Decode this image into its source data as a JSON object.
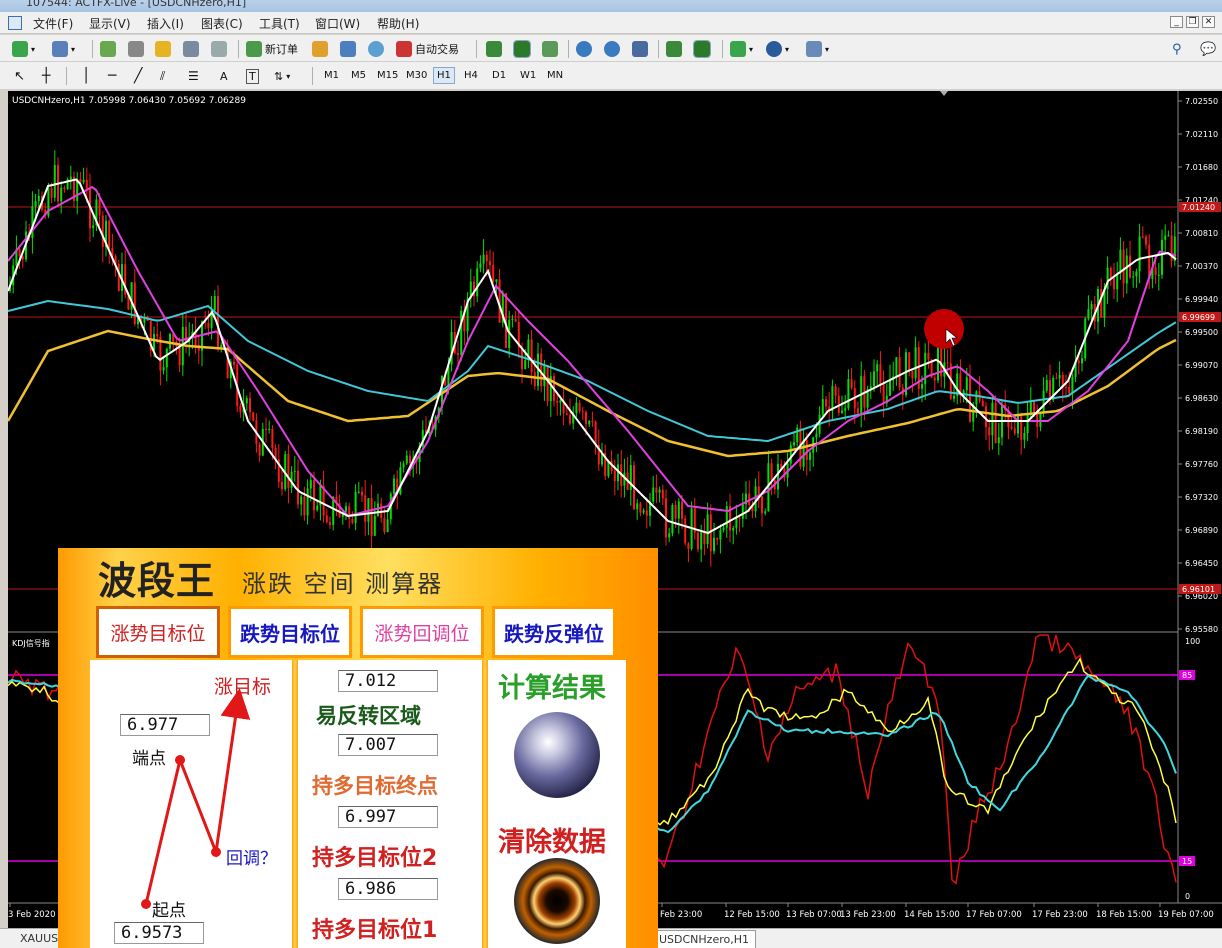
{
  "window": {
    "title": "107544: ACTFX-Live - [USDCNHzero,H1]"
  },
  "menu": [
    "文件(F)",
    "显示(V)",
    "插入(I)",
    "图表(C)",
    "工具(T)",
    "窗口(W)",
    "帮助(H)"
  ],
  "toolbar": {
    "new_order": "新订单",
    "auto_trade": "自动交易"
  },
  "timeframes": [
    "M1",
    "M5",
    "M15",
    "M30",
    "H1",
    "H4",
    "D1",
    "W1",
    "MN"
  ],
  "active_timeframe": "H1",
  "chart": {
    "header": "USDCNHzero,H1  7.05998 7.06430 7.05692 7.06289",
    "price_axis": [
      "7.02550",
      "7.02110",
      "7.01680",
      "7.01240",
      "7.00810",
      "7.00370",
      "6.99940",
      "6.99500",
      "6.99070",
      "6.98630",
      "6.98190",
      "6.97760",
      "6.97320",
      "6.96890",
      "6.96450",
      "6.96020",
      "6.95580"
    ],
    "hline_upper_label": "7.01240",
    "hline_mid_label": "6.99699",
    "hline_lower_label": "6.96101",
    "colors": {
      "up": "#00e000",
      "down": "#ff1a1a",
      "ma_white": "#ffffff",
      "ma_magenta": "#e040e0",
      "ma_cyan": "#40c8d8",
      "ma_yellow": "#f0c030",
      "hline": "#c01818"
    }
  },
  "kdj": {
    "label": "KDJ信号指",
    "axis_top": "100",
    "axis_bottom": "0",
    "level_high": "85",
    "level_low": "15",
    "colors": {
      "k": "#ffff40",
      "d": "#40d8e0",
      "j": "#e01010",
      "levels": "#e000e0"
    }
  },
  "time_axis": [
    "3 Feb 2020",
    "Feb 23:00",
    "12 Feb 15:00",
    "13 Feb 07:00",
    "13 Feb 23:00",
    "14 Feb 15:00",
    "17 Feb 07:00",
    "17 Feb 23:00",
    "18 Feb 15:00",
    "19 Feb 07:00"
  ],
  "status_tabs": [
    "XAUUS",
    "USDCNHzero,H1"
  ],
  "panel": {
    "title": "波段王",
    "subtitle": "涨跌 空间 测算器",
    "tabs": [
      "涨势目标位",
      "跌势目标位",
      "涨势回调位",
      "跌势反弹位"
    ],
    "diagram": {
      "target_label": "涨目标",
      "end_label": "端点",
      "pullback_label": "回调？",
      "start_label": "起点",
      "end_value": "6.977",
      "start_value": "6.9573"
    },
    "results": [
      {
        "value": "7.012",
        "label": "易反转区域"
      },
      {
        "value": "7.007",
        "label": "持多目标终点"
      },
      {
        "value": "6.997",
        "label": "持多目标位2"
      },
      {
        "value": "6.986",
        "label": "持多目标位1"
      }
    ],
    "calc_button": "计算结果",
    "clear_button": "清除数据"
  }
}
